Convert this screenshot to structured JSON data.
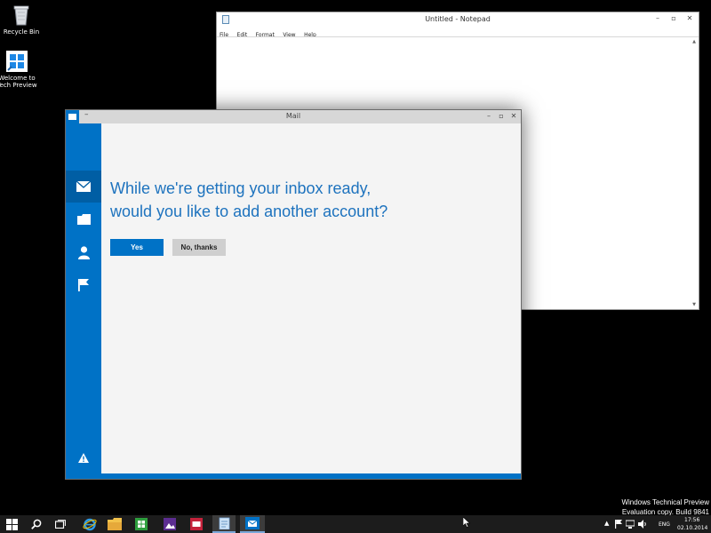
{
  "desktop": {
    "icons": [
      {
        "label": "Recycle Bin",
        "icon": "recycle-bin-icon"
      },
      {
        "label_line1": "Welcome to",
        "label_line2": "Tech Preview",
        "icon": "windows-logo-icon"
      }
    ]
  },
  "notepad": {
    "title": "Untitled - Notepad",
    "menu": [
      "File",
      "Edit",
      "Format",
      "View",
      "Help"
    ],
    "controls": {
      "minimize": "–",
      "maximize": "▫",
      "close": "✕"
    }
  },
  "mail": {
    "title": "Mail",
    "titlebar_dash": "–",
    "controls": {
      "minimize": "–",
      "maximize": "▫",
      "close": "✕"
    },
    "sidebar": [
      "mail-icon",
      "folder-icon",
      "people-icon",
      "flag-icon",
      "warning-icon"
    ],
    "headline_line1": "While we're getting your inbox ready,",
    "headline_line2": "would you like to add another account?",
    "yes_label": "Yes",
    "no_label": "No, thanks",
    "accent": "#0072c6"
  },
  "watermark": {
    "line1": "Windows Technical Preview",
    "line2": "Evaluation copy. Build 9841"
  },
  "taskbar": {
    "apps": [
      "start-icon",
      "search-icon",
      "task-view-icon",
      "internet-explorer-icon",
      "file-explorer-icon",
      "store-icon",
      "photos-icon",
      "news-icon",
      "notepad-icon",
      "mail-icon"
    ],
    "tray": {
      "language": "ENG",
      "time": "17:56",
      "date": "02.10.2014"
    }
  }
}
